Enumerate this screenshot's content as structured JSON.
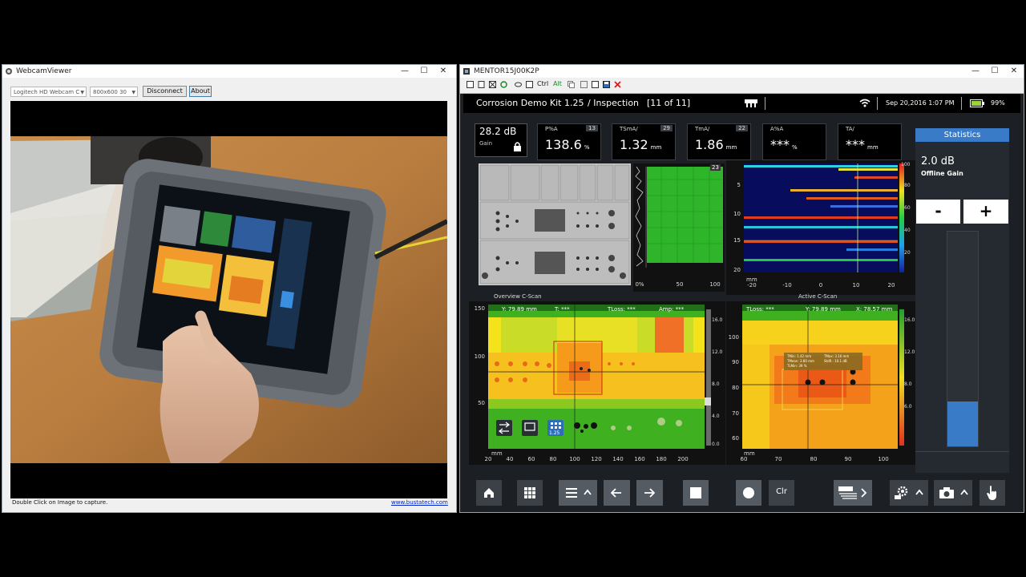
{
  "webcam": {
    "title": "WebcamViewer",
    "device": "Logitech HD Webcam C",
    "resolution": "800x600 30",
    "disconnect_label": "Disconnect",
    "about_label": "About",
    "status_text": "Double Click on Image to capture.",
    "link_text": "www.bustatech.com"
  },
  "mentor": {
    "title": "MENTOR15J00K2P",
    "toolbar": {
      "ctrl_label": "Ctrl",
      "alt_label": "Alt"
    },
    "header": {
      "kit_title": "Corrosion Demo Kit 1.25",
      "inspection": "/ Inspection",
      "inspection_count": "[11 of 11]",
      "datetime": "Sep 20,2016 1:07 PM",
      "battery": "99%"
    },
    "gain": {
      "value": "28.2 dB",
      "label": "Gain"
    },
    "tiles": [
      {
        "label": "P%A",
        "count": "13",
        "value": "138.6",
        "unit": "%"
      },
      {
        "label": "TSmA/",
        "count": "29",
        "value": "1.32",
        "unit": "mm"
      },
      {
        "label": "TmA/",
        "count": "22",
        "value": "1.86",
        "unit": "mm"
      },
      {
        "label": "A%A",
        "count": "",
        "value": "***",
        "unit": "%"
      },
      {
        "label": "TA/",
        "count": "",
        "value": "***",
        "unit": "mm"
      }
    ],
    "statistics": {
      "title": "Statistics",
      "offline_gain_value": "2.0 dB",
      "offline_gain_label": "Offline Gain",
      "minus_label": "-",
      "plus_label": "+",
      "bar_level": 0.21
    },
    "ascan": {
      "badge": "23",
      "x_ticks": [
        "0%",
        "50",
        "100"
      ]
    },
    "bscan": {
      "y_ticks": [
        "5",
        "10",
        "15",
        "20"
      ],
      "x_ticks": [
        "-20",
        "-10",
        "0",
        "10",
        "20"
      ],
      "unit": "mm",
      "colorbar_ticks": [
        "100",
        "80",
        "60",
        "40",
        "20"
      ]
    },
    "overview": {
      "title": "Overview C-Scan",
      "readout_y": "Y: 79.89 mm",
      "readout_t": "T: ***",
      "readout_tloss": "TLoss: ***",
      "readout_amp": "Amp: ***",
      "y_ticks": [
        "150",
        "100",
        "50"
      ],
      "x_ticks": [
        "20",
        "40",
        "60",
        "80",
        "100",
        "120",
        "140",
        "160",
        "180",
        "200"
      ],
      "unit": "mm",
      "colorbar_ticks": [
        "16.0",
        "12.0",
        "8.0",
        "4.0",
        "0.0"
      ],
      "overlay_count": "1.25"
    },
    "active": {
      "title": "Active C-Scan",
      "readout_tloss": "TLoss: ***",
      "readout_y": "Y: 79.89 mm",
      "readout_x": "X: 78.57 mm",
      "y_ticks": [
        "100",
        "90",
        "80",
        "70",
        "60"
      ],
      "x_ticks": [
        "60",
        "70",
        "80",
        "90",
        "100"
      ],
      "unit": "mm",
      "colorbar_ticks": [
        "16.0",
        "12.0",
        "8.0",
        "6.0"
      ],
      "tip_lines": [
        "TMin: 1.42 mm",
        "TMax: 3.16 mm",
        "TMean: 3.80 mm",
        "StdR.: 10.1 dB",
        "TLMin: 39 %"
      ]
    },
    "bottombar": {
      "clr_label": "Clr"
    }
  },
  "colors": {
    "accent_blue": "#2e6eb8",
    "stat_header": "#3a7bc8",
    "cscan_green": "#3fb020",
    "cscan_yellow": "#f4e21a",
    "cscan_orange": "#f59a1a"
  }
}
